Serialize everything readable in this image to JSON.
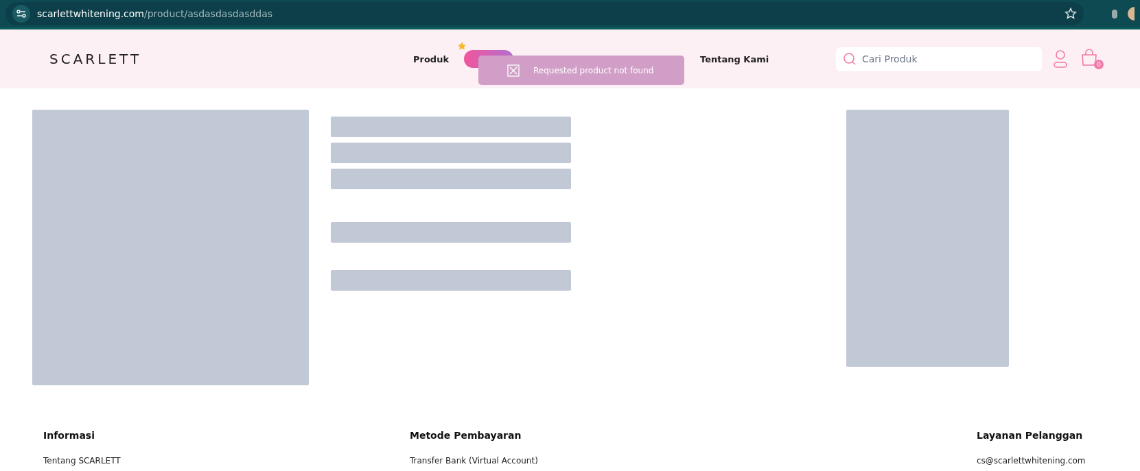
{
  "browser": {
    "url_host": "scarlettwhitening.com",
    "url_path": "/product/asdasdasdasddas"
  },
  "header": {
    "logo": "SCARLETT",
    "nav": [
      {
        "label": "Produk",
        "kind": "link"
      },
      {
        "kind": "promo"
      },
      {
        "label": "Tentang Kami",
        "kind": "link"
      }
    ],
    "search": {
      "placeholder": "Cari Produk"
    },
    "cart_count": "0"
  },
  "toast": {
    "message": "Requested product not found"
  },
  "footer": {
    "columns": [
      {
        "title": "Informasi",
        "links": [
          "Tentang SCARLETT"
        ]
      },
      {
        "title": "Metode Pembayaran",
        "links": [
          "Transfer Bank (Virtual Account)"
        ]
      },
      {
        "title": "Layanan Pelanggan",
        "links": [
          "cs@scarlettwhitening.com"
        ]
      }
    ]
  }
}
